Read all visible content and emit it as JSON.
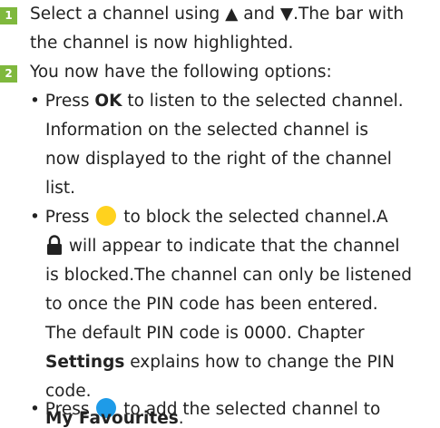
{
  "steps": [
    {
      "number": "1",
      "lines": [
        "Select a channel using ▲ and ▼.The bar with",
        "the channel is now highlighted."
      ]
    },
    {
      "number": "2",
      "intro": "You now have the following options:",
      "options": {
        "ok": {
          "line1_pre": "Press ",
          "key": "OK",
          "line1_post": " to listen to the selected channel.",
          "lines": [
            "Information on the selected channel is",
            "now displayed to the right of the channel",
            "list."
          ]
        },
        "block": {
          "pre": "Press ",
          "post": " to block the selected channel.A",
          "lock_post": " will appear to indicate that the channel",
          "lines": [
            "is blocked.The channel can only be listened",
            "to once the PIN code has been entered.",
            "The default PIN code is 0000. Chapter"
          ],
          "settings": "Settings",
          "settings_post": " explains how to change the PIN",
          "last": "code."
        },
        "fav": {
          "pre": "Press ",
          "post": " to add the selected channel to",
          "bold": "My Favourites",
          "bold_post": "."
        }
      }
    }
  ],
  "colors": {
    "step_badge": "#7fb83d",
    "yellow_key": "#ffd21e",
    "blue_key": "#1e9be8"
  },
  "icons": {
    "yellow": "yellow-button-icon",
    "blue": "blue-button-icon",
    "lock": "lock-icon"
  }
}
